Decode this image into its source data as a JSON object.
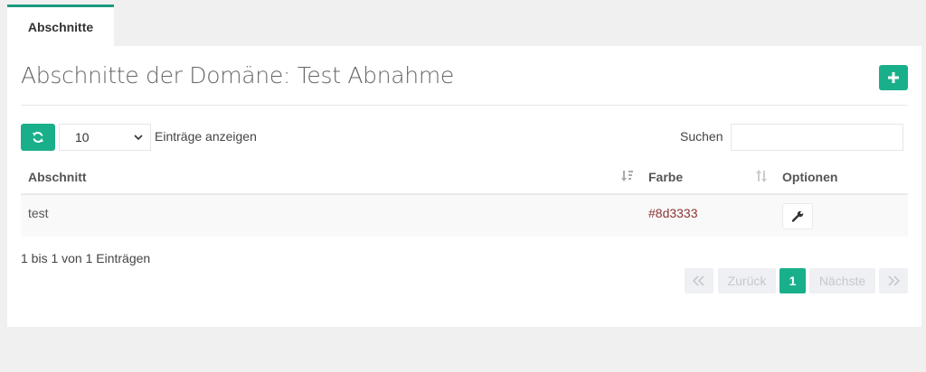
{
  "tabs": [
    {
      "label": "Abschnitte"
    }
  ],
  "page": {
    "title": "Abschnitte der Domäne: Test Abnahme"
  },
  "toolbar": {
    "length_value": "10",
    "length_label": "Einträge anzeigen",
    "search_label": "Suchen",
    "search_value": ""
  },
  "table": {
    "columns": [
      "Abschnitt",
      "Farbe",
      "Optionen"
    ],
    "rows": [
      {
        "abschnitt": "test",
        "farbe": "#8d3333",
        "farbe_color": "#8d3333"
      }
    ]
  },
  "footer": {
    "info": "1 bis 1 von 1 Einträgen"
  },
  "pagination": {
    "prev_label": "Zurück",
    "current_page": "1",
    "next_label": "Nächste"
  },
  "colors": {
    "accent": "#1aaf8b",
    "tab_border": "#1a9a80",
    "link": "#8d3333"
  }
}
